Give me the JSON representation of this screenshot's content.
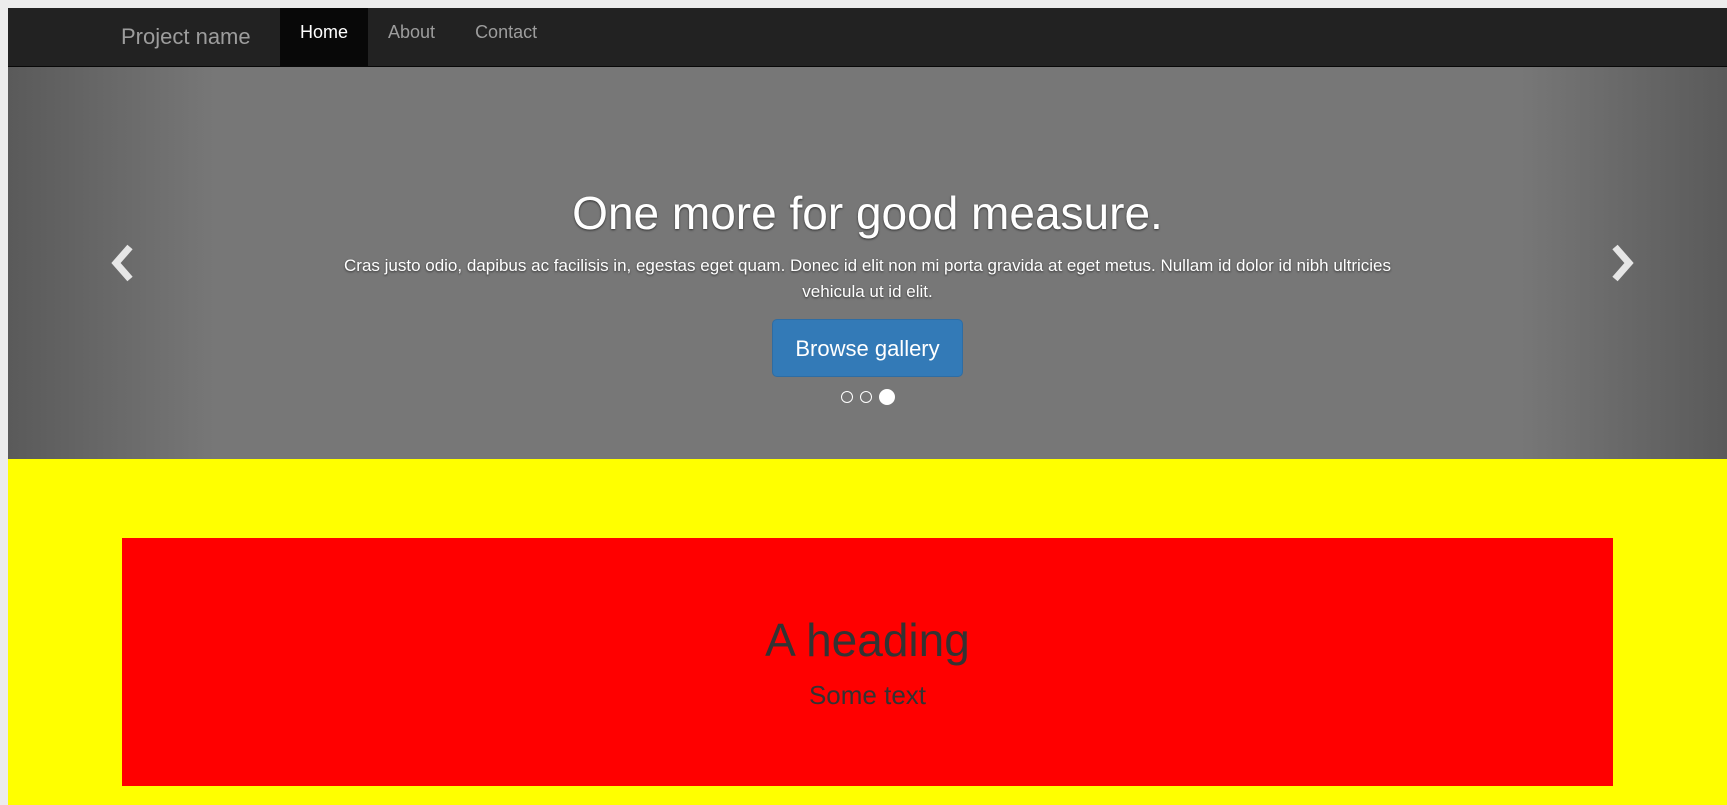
{
  "navbar": {
    "brand": "Project name",
    "items": [
      {
        "label": "Home",
        "active": true
      },
      {
        "label": "About",
        "active": false
      },
      {
        "label": "Contact",
        "active": false
      }
    ]
  },
  "carousel": {
    "heading": "One more for good measure.",
    "text": "Cras justo odio, dapibus ac facilisis in, egestas eget quam. Donec id elit non mi porta gravida at eget metus. Nullam id dolor id nibh ultricies vehicula ut id elit.",
    "button_label": "Browse gallery",
    "prev_icon": "chevron-left-icon",
    "next_icon": "chevron-right-icon",
    "slide_count": 3,
    "active_slide": 3
  },
  "jumbotron": {
    "heading": "A heading",
    "text": "Some text"
  },
  "colors": {
    "navbar": "#222222",
    "primary": "#337ab7",
    "section_bg": "#ffff00",
    "panel_bg": "#ff0000"
  }
}
